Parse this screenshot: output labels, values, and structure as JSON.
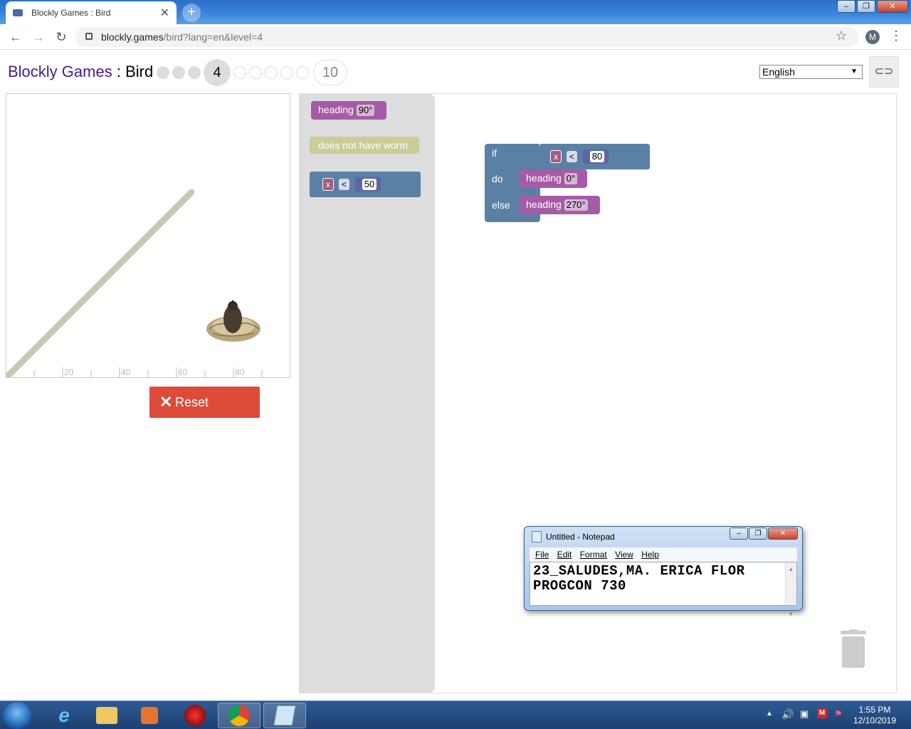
{
  "browser": {
    "tab_title": "Blockly Games : Bird",
    "url_host": "blockly.games",
    "url_rest": "/bird?lang=en&level=4",
    "profile_initial": "M"
  },
  "header": {
    "brand": "Blockly Games",
    "separator": " : ",
    "game": "Bird",
    "current_level": "4",
    "last_level": "10",
    "language": "English"
  },
  "viz": {
    "ticks": [
      "20",
      "40",
      "60",
      "80"
    ]
  },
  "controls": {
    "reset_label": "Reset"
  },
  "flyout": {
    "heading_label": "heading",
    "heading_value": "90°",
    "worm_label": "does not have worm",
    "compare_var": "x",
    "compare_op": "<",
    "compare_value": "50"
  },
  "program": {
    "if_label": "if",
    "do_label": "do",
    "else_label": "else",
    "cond_var": "x",
    "cond_op": "<",
    "cond_value": "80",
    "do_heading_label": "heading",
    "do_heading_value": "0°",
    "else_heading_label": "heading",
    "else_heading_value": "270°"
  },
  "notepad": {
    "title": "Untitled - Notepad",
    "menu": [
      "File",
      "Edit",
      "Format",
      "View",
      "Help"
    ],
    "line1": "23_SALUDES,MA. ERICA FLOR",
    "line2": "PROGCON 730"
  },
  "taskbar": {
    "time": "1:55 PM",
    "date": "12/10/2019"
  },
  "colors": {
    "brand_purple": "#4a1a8a",
    "reset_red": "#dd4b39",
    "logic_blue": "#5b80a5",
    "heading_purple": "#a55ba5",
    "variable_pink": "#a55b80",
    "number_blue": "#5b67a5",
    "worm_olive": "#cccc99"
  }
}
